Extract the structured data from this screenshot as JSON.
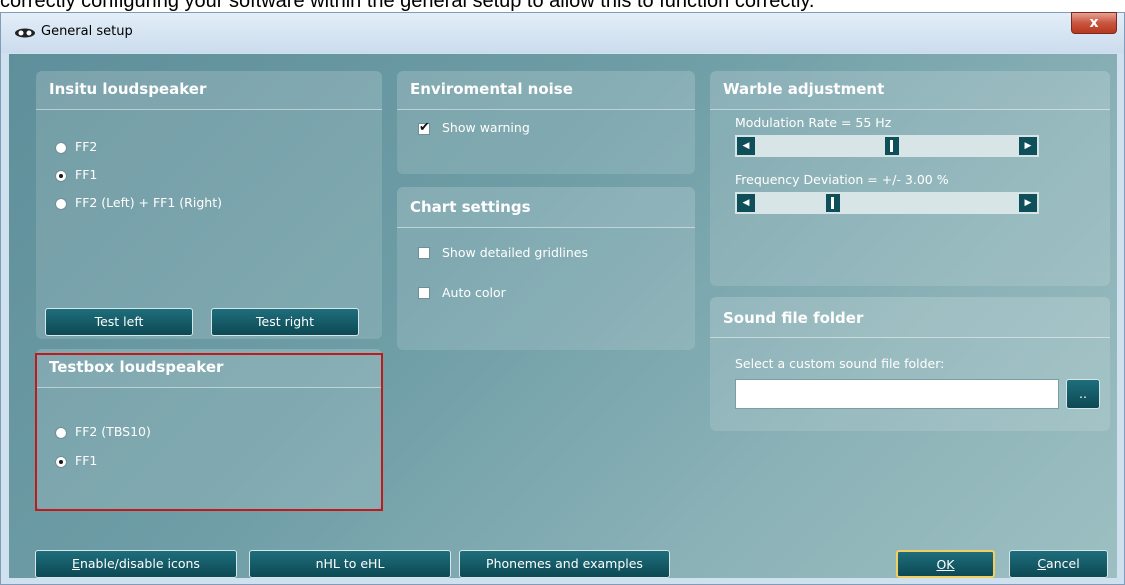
{
  "caption": "correctly configuring your software within the general setup to allow this to function correctly.",
  "window": {
    "title": "General setup",
    "close_label": "x"
  },
  "insitu": {
    "title": "Insitu loudspeaker",
    "options": [
      {
        "label": "FF2",
        "checked": false
      },
      {
        "label": "FF1",
        "checked": true
      },
      {
        "label": "FF2 (Left) + FF1 (Right)",
        "checked": false
      }
    ],
    "test_left": "Test left",
    "test_right": "Test right"
  },
  "testbox": {
    "title": "Testbox loudspeaker",
    "options": [
      {
        "label": "FF2 (TBS10)",
        "checked": false
      },
      {
        "label": "FF1",
        "checked": true
      }
    ]
  },
  "env_noise": {
    "title": "Enviromental noise",
    "show_warning": "Show warning",
    "show_warning_checked": true
  },
  "chart_settings": {
    "title": "Chart settings",
    "gridlines": "Show detailed gridlines",
    "gridlines_checked": false,
    "auto_color": "Auto color",
    "auto_color_checked": false
  },
  "warble": {
    "title": "Warble adjustment",
    "modulation_label": "Modulation Rate = 55 Hz",
    "modulation_position": 0.52,
    "deviation_label": "Frequency Deviation = +/- 3.00 %",
    "deviation_position": 0.28
  },
  "sound_folder": {
    "title": "Sound file folder",
    "prompt": "Select a custom sound file folder:",
    "value": "",
    "browse": ".."
  },
  "footer": {
    "enable_icons": "Enable/disable icons",
    "nhl_ehl": "nHL to eHL",
    "phonemes": "Phonemes and examples",
    "ok": "OK",
    "cancel": "Cancel"
  },
  "colors": {
    "accent": "#0c4954",
    "highlight": "#c01b1b",
    "ok_border": "#f3cf62"
  }
}
